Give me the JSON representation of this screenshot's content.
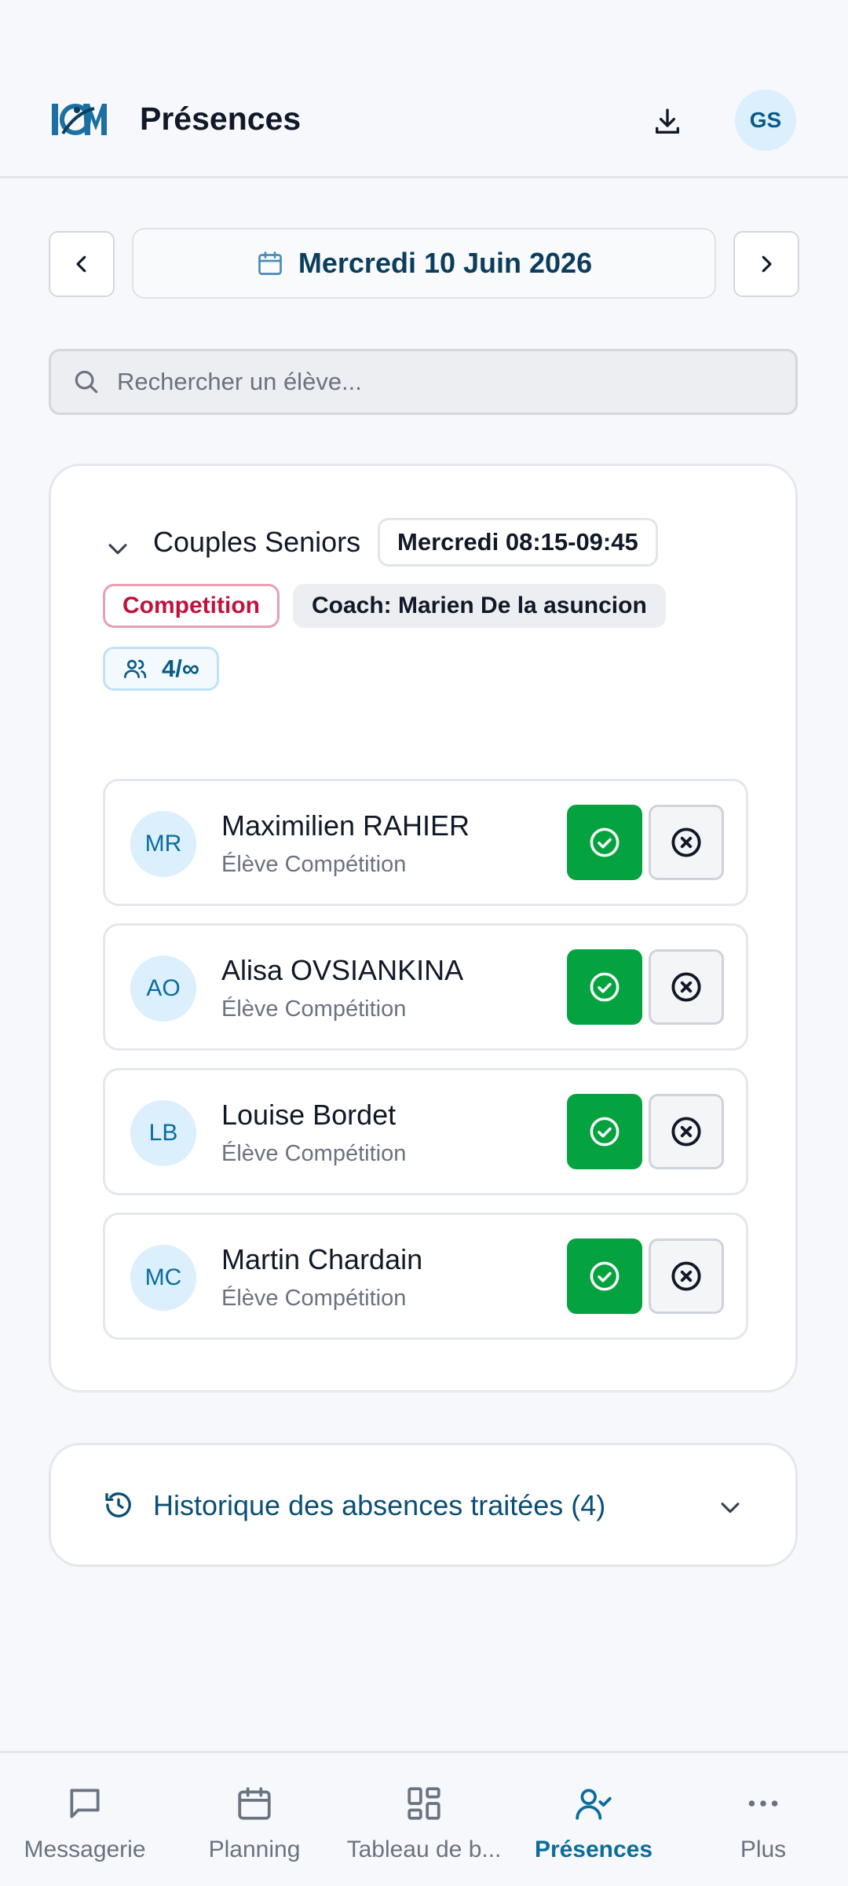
{
  "header": {
    "title": "Présences",
    "avatar_initials": "GS"
  },
  "date_nav": {
    "date_label": "Mercredi 10 Juin 2026"
  },
  "search": {
    "placeholder": "Rechercher un élève..."
  },
  "class": {
    "name": "Couples Seniors",
    "time": "Mercredi 08:15-09:45",
    "category": "Competition",
    "coach": "Coach: Marien De la asuncion",
    "capacity": "4/∞"
  },
  "students": [
    {
      "initials": "MR",
      "name": "Maximilien RAHIER",
      "role": "Élève Compétition"
    },
    {
      "initials": "AO",
      "name": "Alisa OVSIANKINA",
      "role": "Élève Compétition"
    },
    {
      "initials": "LB",
      "name": "Louise Bordet",
      "role": "Élève Compétition"
    },
    {
      "initials": "MC",
      "name": "Martin Chardain",
      "role": "Élève Compétition"
    }
  ],
  "history": {
    "label": "Historique des absences traitées (4)"
  },
  "nav": [
    {
      "label": "Messagerie",
      "icon": "message-icon"
    },
    {
      "label": "Planning",
      "icon": "calendar-icon"
    },
    {
      "label": "Tableau de b...",
      "icon": "dashboard-icon"
    },
    {
      "label": "Présences",
      "icon": "user-check-icon",
      "active": true
    },
    {
      "label": "Plus",
      "icon": "more-icon"
    }
  ],
  "colors": {
    "accent": "#0a6d9e",
    "present": "#05a33f",
    "competition": "#c0123f",
    "title": "#0b3d5c"
  }
}
